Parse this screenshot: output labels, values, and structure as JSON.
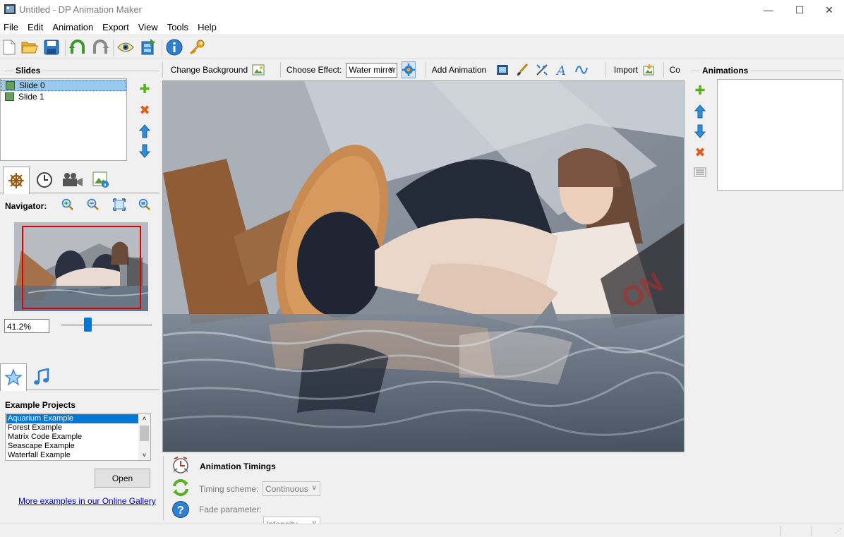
{
  "window": {
    "title": "Untitled - DP Animation Maker"
  },
  "menu": [
    "File",
    "Edit",
    "Animation",
    "Export",
    "View",
    "Tools",
    "Help"
  ],
  "toolbar_icons": [
    "new-file-icon",
    "open-folder-icon",
    "save-icon",
    "undo-icon",
    "redo-icon",
    "preview-icon",
    "export-video-icon",
    "about-icon",
    "key-icon"
  ],
  "slides": {
    "title": "Slides",
    "items": [
      {
        "label": "Slide 0",
        "selected": true
      },
      {
        "label": "Slide 1",
        "selected": false
      }
    ]
  },
  "navigator": {
    "label": "Navigator:",
    "zoom_value": "41.2%",
    "zoom_level": 0.27
  },
  "examples": {
    "title": "Example Projects",
    "items": [
      "Aquarium Example",
      "Forest Example",
      "Matrix Code Example",
      "Seascape Example",
      "Waterfall Example"
    ],
    "selected_index": 0,
    "open_label": "Open",
    "gallery_link": "More examples in our Online Gallery"
  },
  "commands": {
    "change_background": "Change Background",
    "choose_effect_label": "Choose Effect:",
    "effect_value": "Water mirror",
    "add_animation": "Add Animation",
    "import": "Import",
    "truncated": "Co"
  },
  "animations": {
    "title": "Animations"
  },
  "timings": {
    "title": "Animation Timings",
    "timing_scheme_label": "Timing scheme:",
    "timing_scheme_value": "Continuous",
    "fade_param_label": "Fade parameter:",
    "fade_param_value": "Intensity"
  },
  "colors": {
    "selection": "#99c9ef",
    "list_selection": "#0078d7",
    "link": "#0000cc",
    "accent_green": "#58b020",
    "accent_red": "#e35b1c",
    "accent_blue": "#2e8fd8"
  }
}
